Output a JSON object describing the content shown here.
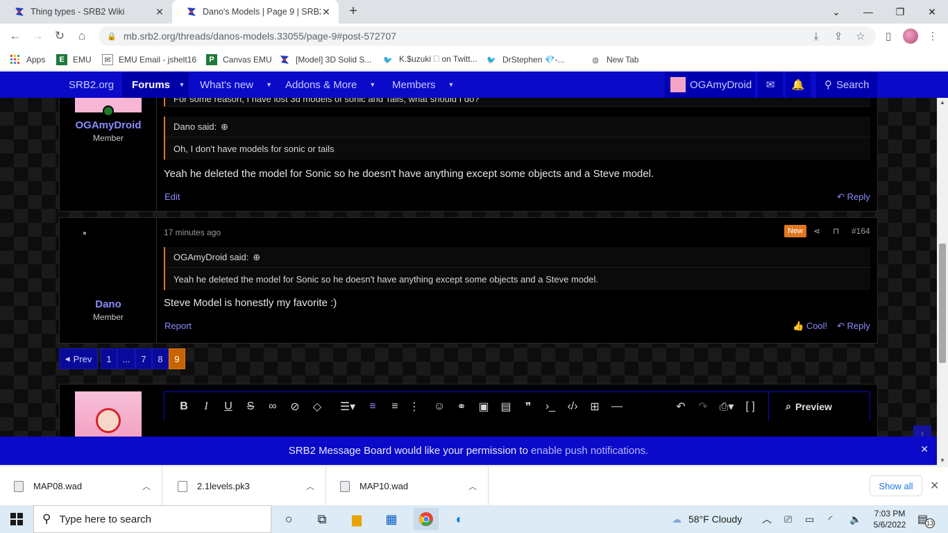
{
  "browser": {
    "tabs": [
      {
        "title": "Thing types - SRB2 Wiki"
      },
      {
        "title": "Dano's Models | Page 9 | SRB2 M"
      }
    ],
    "new_tab_icon": "+",
    "url": "mb.srb2.org/threads/danos-models.33055/page-9#post-572707",
    "bookmarks": [
      "Apps",
      "EMU",
      "EMU Email - jshelt16",
      "Canvas EMU",
      "[Model] 3D Solid S...",
      "K.$uzuki 🗆 on Twitt...",
      "DrStephen 💎-...",
      "New Tab"
    ]
  },
  "forum_nav": {
    "items": [
      "SRB2.org",
      "Forums",
      "What's new",
      "Addons & More",
      "Members"
    ],
    "user": "OGAmyDroid",
    "search": "Search"
  },
  "post1": {
    "author": "OGAmyDroid",
    "role": "Member",
    "quoted_top": "For some reason, I have lost 3d models of sonic and Tails, what should I do?",
    "quote_author": "Dano said:",
    "quote_text": "Oh, I don't have models for sonic or tails",
    "body": "Yeah he deleted the model for Sonic so he doesn't have anything except some objects and a Steve model.",
    "edit": "Edit",
    "reply": "Reply"
  },
  "post2": {
    "author": "Dano",
    "role": "Member",
    "time": "17 minutes ago",
    "badge": "New",
    "number": "#164",
    "quote_author": "OGAmyDroid said:",
    "quote_text": "Yeah he deleted the model for Sonic so he doesn't have anything except some objects and a Steve model.",
    "body": "Steve Model is honestly my favorite :)",
    "report": "Report",
    "cool": "Cool!",
    "reply": "Reply"
  },
  "pagination": {
    "prev": "Prev",
    "pages": [
      "1",
      "...",
      "7",
      "8",
      "9"
    ]
  },
  "editor": {
    "preview": "Preview"
  },
  "push_banner": {
    "text": "SRB2 Message Board would like your permission to",
    "link": "enable push notifications."
  },
  "downloads": {
    "items": [
      "MAP08.wad",
      "2.1levels.pk3",
      "MAP10.wad"
    ],
    "show_all": "Show all"
  },
  "taskbar": {
    "search_placeholder": "Type here to search",
    "weather": "58°F  Cloudy",
    "time": "7:03 PM",
    "date": "5/6/2022",
    "notifications": "13"
  },
  "colors": {
    "forum_blue": "#0a0ac8",
    "link_purple": "#8b8bff",
    "new_badge": "#e07820",
    "page_active": "#c86400"
  }
}
